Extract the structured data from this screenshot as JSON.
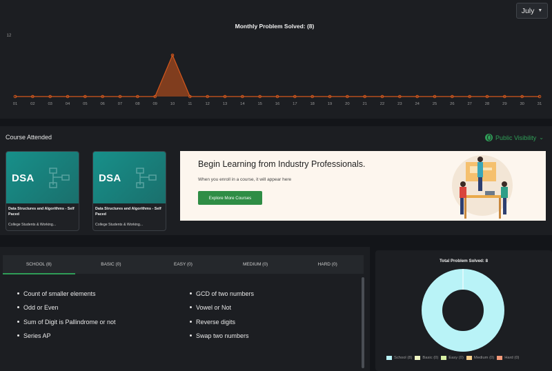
{
  "month_select": {
    "value": "July"
  },
  "chart_data": {
    "type": "area",
    "title": "Monthly Problem Solved: (8)",
    "categories": [
      "01",
      "02",
      "03",
      "04",
      "05",
      "06",
      "07",
      "08",
      "09",
      "10",
      "11",
      "12",
      "13",
      "14",
      "15",
      "16",
      "17",
      "18",
      "19",
      "20",
      "21",
      "22",
      "23",
      "24",
      "25",
      "26",
      "27",
      "28",
      "29",
      "30",
      "31"
    ],
    "series": [
      {
        "values": [
          0,
          0,
          0,
          0,
          0,
          0,
          0,
          0,
          0,
          8,
          0,
          0,
          0,
          0,
          0,
          0,
          0,
          0,
          0,
          0,
          0,
          0,
          0,
          0,
          0,
          0,
          0,
          0,
          0,
          0,
          0
        ]
      }
    ],
    "ylim": [
      0,
      12
    ],
    "yticks": [
      "12"
    ],
    "colors": {
      "line": "#d4571c",
      "fill": "#d4571c"
    }
  },
  "course_section": {
    "title": "Course Attended",
    "visibility_label": "Public Visibility",
    "cards": [
      {
        "badge": "DSA",
        "name": "Data Structures and Algorithms - Self Paced",
        "audience": "College Students & Working..."
      },
      {
        "badge": "DSA",
        "name": "Data Structures and Algorithms - Self Paced",
        "audience": "College Students & Working..."
      }
    ],
    "banner": {
      "headline": "Begin Learning from Industry Professionals.",
      "subtext": "When you enroll in a course, it will appear here",
      "button_label": "Explore More Courses"
    }
  },
  "problems": {
    "tabs": [
      "SCHOOL (8)",
      "BASIC (0)",
      "EASY (0)",
      "MEDIUM (0)",
      "HARD (0)"
    ],
    "active_tab": 0,
    "left_list": [
      "Count of smaller elements",
      "Odd or Even",
      "Sum of Digit is Pallindrome or not",
      "Series AP"
    ],
    "right_list": [
      "GCD of two numbers",
      "Vowel or Not",
      "Reverse digits",
      "Swap two numbers"
    ]
  },
  "donut": {
    "title": "Total Problem Solved: 8",
    "legend": [
      {
        "label": "School (8)",
        "color": "#b9f3f7"
      },
      {
        "label": "Basic (0)",
        "color": "#eef4c3"
      },
      {
        "label": "Easy (0)",
        "color": "#d8f0a4"
      },
      {
        "label": "Medium (0)",
        "color": "#f7cf8c"
      },
      {
        "label": "Hard (0)",
        "color": "#f39a7a"
      }
    ],
    "values": [
      8,
      0,
      0,
      0,
      0
    ]
  },
  "colors": {
    "accent_green": "#2f9e57",
    "panel_bg": "#1c1e22",
    "page_bg": "#131519"
  }
}
